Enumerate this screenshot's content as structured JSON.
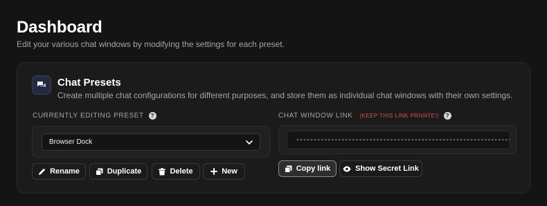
{
  "header": {
    "title": "Dashboard",
    "subtitle": "Edit your various chat windows by modifying the settings for each preset."
  },
  "card": {
    "icon": "chat-bubbles-icon",
    "title": "Chat Presets",
    "description": "Create multiple chat configurations for different purposes, and store them as individual chat windows with their own settings."
  },
  "preset": {
    "label": "CURRENTLY EDITING PRESET",
    "selected": "Browser Dock",
    "buttons": {
      "rename": "Rename",
      "duplicate": "Duplicate",
      "delete": "Delete",
      "new": "New"
    }
  },
  "link": {
    "label": "CHAT WINDOW LINK",
    "warning": "(KEEP THIS LINK PRIVATE!)",
    "value": "-----------------------------------------------------------------",
    "buttons": {
      "copy": "Copy link",
      "show_secret": "Show Secret Link"
    }
  },
  "colors": {
    "background": "#141414",
    "card": "#1b1b1b",
    "warning": "#e05252",
    "icon_accent": "#262a3e"
  }
}
